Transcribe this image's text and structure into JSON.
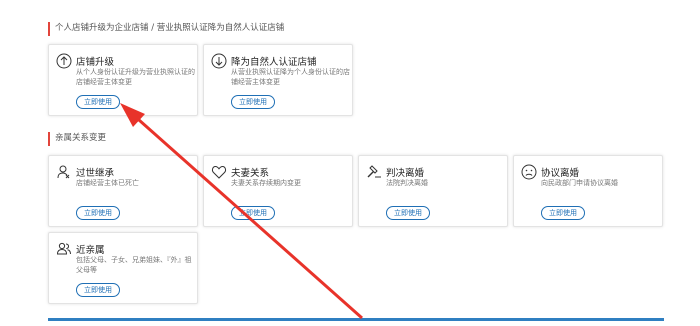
{
  "sections": {
    "upgrade_title": "个人店铺升级为企业店铺 / 营业执照认证降为自然人认证店铺",
    "family_title": "亲属关系变更"
  },
  "use_label": "立即使用",
  "cards": {
    "store_upgrade": {
      "title": "店铺升级",
      "desc": "从个人身份认证升级为营业执照认证的店铺经营主体变更",
      "icon": "arrow-up-circle-icon"
    },
    "downgrade": {
      "title": "降为自然人认证店铺",
      "desc": "从营业执照认证降为个人身份认证的店铺经营主体变更",
      "icon": "arrow-down-circle-icon"
    },
    "inherit": {
      "title": "过世继承",
      "desc": "店铺经营主体已死亡",
      "icon": "person-memorial-icon"
    },
    "spouse": {
      "title": "夫妻关系",
      "desc": "夫妻关系存续期内变更",
      "icon": "heart-icon"
    },
    "judicial": {
      "title": "判决离婚",
      "desc": "法院判决离婚",
      "icon": "gavel-icon"
    },
    "agreement": {
      "title": "协议离婚",
      "desc": "向民政部门申请协议离婚",
      "icon": "sad-face-icon"
    },
    "relatives": {
      "title": "近亲属",
      "desc": "包括父母、子女、兄弟姐妹、『外』祖父母等",
      "icon": "people-icon"
    }
  },
  "colors": {
    "accent_blue": "#1f6fb5",
    "section_marker": "#e2453c",
    "annotation_arrow": "#e8332a"
  }
}
